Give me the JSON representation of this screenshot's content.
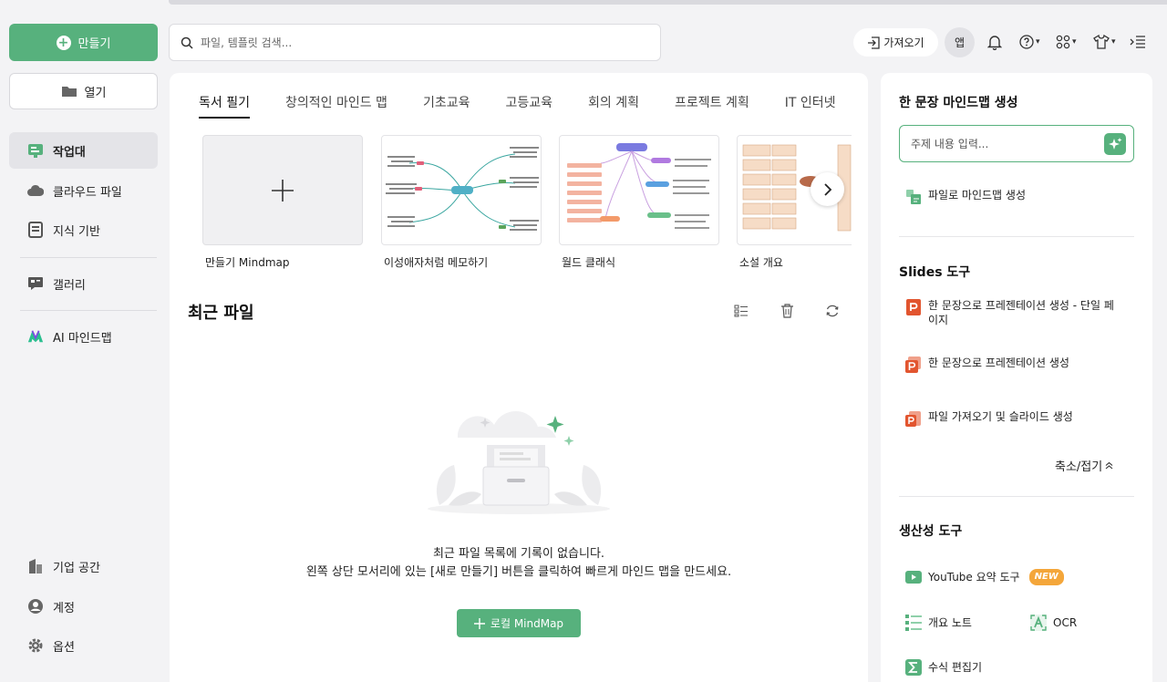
{
  "sidebar": {
    "create_label": "만들기",
    "open_label": "열기",
    "items": [
      {
        "label": "작업대",
        "icon": "workbench-icon"
      },
      {
        "label": "클라우드 파일",
        "icon": "cloud-icon"
      },
      {
        "label": "지식 기반",
        "icon": "book-icon"
      },
      {
        "label": "갤러리",
        "icon": "gallery-icon"
      },
      {
        "label": "AI 마인드맵",
        "icon": "ai-mindmap-icon"
      }
    ],
    "bottom_items": [
      {
        "label": "기업 공간",
        "icon": "building-icon"
      },
      {
        "label": "계정",
        "icon": "account-icon"
      },
      {
        "label": "옵션",
        "icon": "gear-icon"
      }
    ]
  },
  "search": {
    "placeholder": "파일, 템플릿 검색..."
  },
  "toolbar": {
    "import_label": "가져오기",
    "app_label": "앱"
  },
  "main": {
    "tabs": [
      "독서 필기",
      "창의적인 마인드 맵",
      "기초교육",
      "고등교육",
      "회의 계획",
      "프로젝트 계획",
      "IT 인터넷"
    ],
    "templates": [
      {
        "label": "만들기 Mindmap"
      },
      {
        "label": "이성애자처럼 메모하기"
      },
      {
        "label": "월드 클래식"
      },
      {
        "label": "소설 개요"
      }
    ],
    "recent_title": "최근 파일",
    "empty_line1": "최근 파일 목록에 기록이 없습니다.",
    "empty_line2": "왼쪽 상단 모서리에 있는 [새로 만들기] 버튼을 클릭하여 빠르게 마인드 맵을 만드세요.",
    "local_button": "로컬 MindMap"
  },
  "right": {
    "ai_title": "한 문장 마인드맵 생성",
    "topic_placeholder": "주제 내용 입력...",
    "file_to_mindmap": "파일로 마인드맵 생성",
    "slides_title": "Slides 도구",
    "slides_items": [
      "한 문장으로 프레젠테이션 생성 - 단일 페이지",
      "한 문장으로 프레젠테이션 생성",
      "파일 가져오기 및 슬라이드 생성"
    ],
    "collapse_label": "축소/접기",
    "productivity_title": "생산성 도구",
    "youtube_label": "YouTube 요약 도구",
    "new_badge": "NEW",
    "outline_label": "개요 노트",
    "ocr_label": "OCR",
    "formula_label": "수식 편집기"
  },
  "colors": {
    "accent": "#57b17d",
    "slides": "#e2552f",
    "badge": "#f4a63a"
  }
}
